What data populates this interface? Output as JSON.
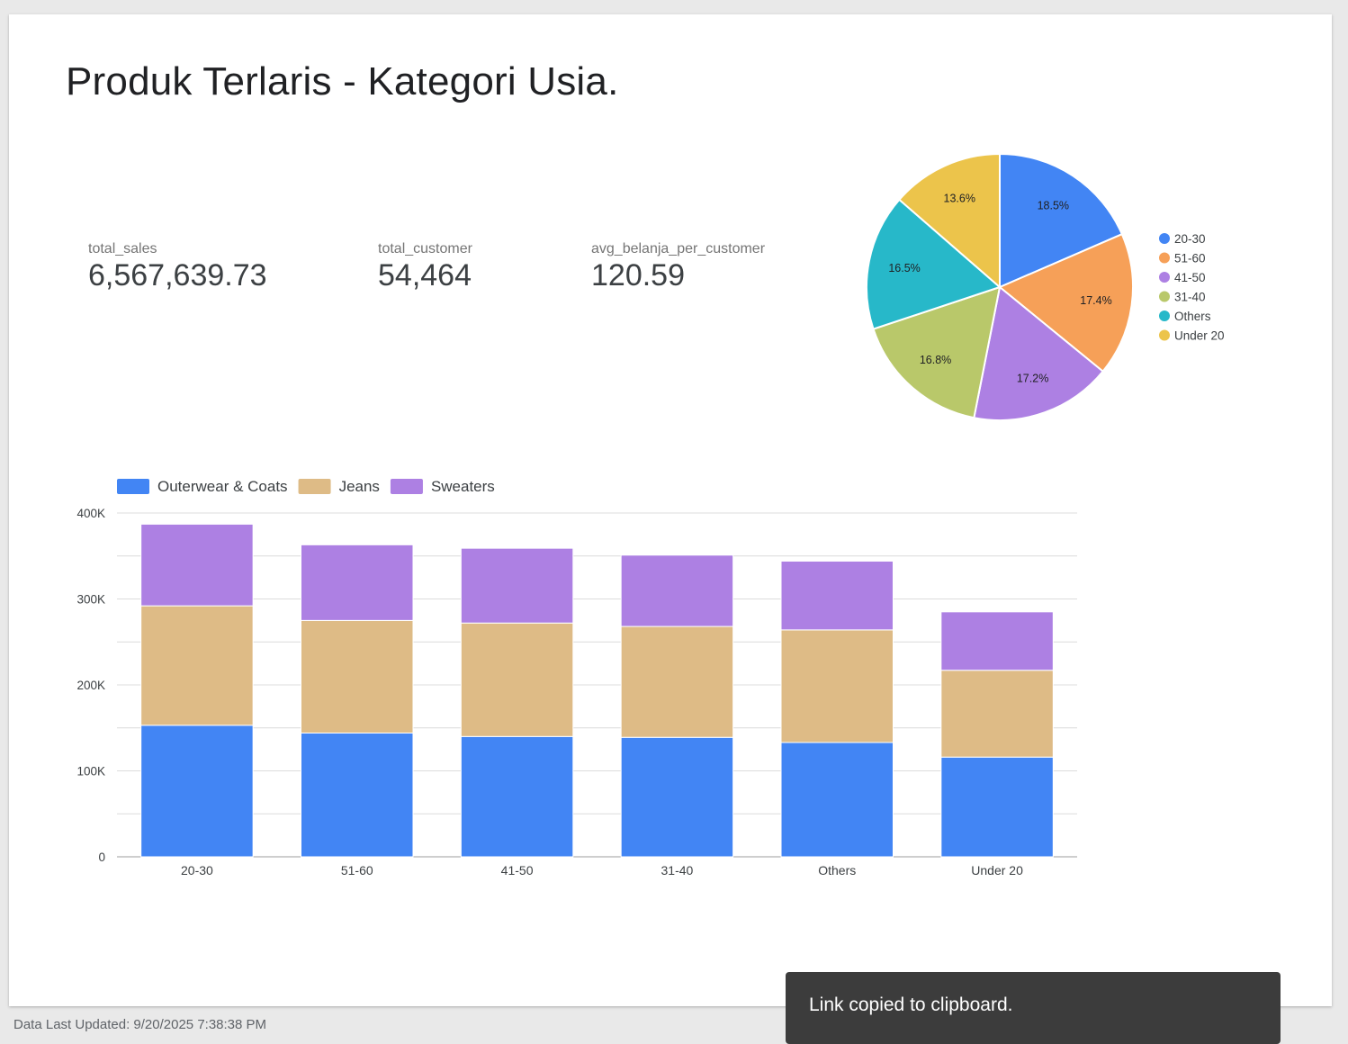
{
  "page": {
    "title": "Produk Terlaris - Kategori Usia."
  },
  "scorecards": [
    {
      "label": "total_sales",
      "value": "6,567,639.73"
    },
    {
      "label": "total_customer",
      "value": "54,464"
    },
    {
      "label": "avg_belanja_per_customer",
      "value": "120.59"
    }
  ],
  "footer": {
    "text": "Data Last Updated: 9/20/2025 7:38:38 PM"
  },
  "toast": {
    "text": "Link copied to clipboard."
  },
  "chart_data": [
    {
      "type": "pie",
      "categories": [
        "20-30",
        "51-60",
        "41-50",
        "31-40",
        "Others",
        "Under 20"
      ],
      "values": [
        18.5,
        17.4,
        17.2,
        16.8,
        16.5,
        13.6
      ],
      "labels": [
        "18.5%",
        "17.4%",
        "17.2%",
        "16.8%",
        "16.5%",
        "13.6%"
      ],
      "colors": [
        "#4285f4",
        "#f6a058",
        "#ad80e3",
        "#b9c86a",
        "#27b8c9",
        "#ecc44b"
      ],
      "legend": "right"
    },
    {
      "type": "bar",
      "stacked": true,
      "categories": [
        "20-30",
        "51-60",
        "41-50",
        "31-40",
        "Others",
        "Under 20"
      ],
      "series": [
        {
          "name": "Outerwear & Coats",
          "color": "#4285f4",
          "values": [
            153000,
            144000,
            140000,
            139000,
            133000,
            116000
          ]
        },
        {
          "name": "Jeans",
          "color": "#debb86",
          "values": [
            139000,
            131000,
            132000,
            129000,
            131000,
            101000
          ]
        },
        {
          "name": "Sweaters",
          "color": "#ad80e3",
          "values": [
            95000,
            88000,
            87000,
            83000,
            80000,
            68000
          ]
        }
      ],
      "ylim": [
        0,
        400000
      ],
      "yticks": [
        0,
        100000,
        200000,
        300000,
        400000
      ],
      "ytick_labels": [
        "0",
        "100K",
        "200K",
        "300K",
        "400K"
      ],
      "grid": true,
      "legend": "top-left"
    }
  ]
}
